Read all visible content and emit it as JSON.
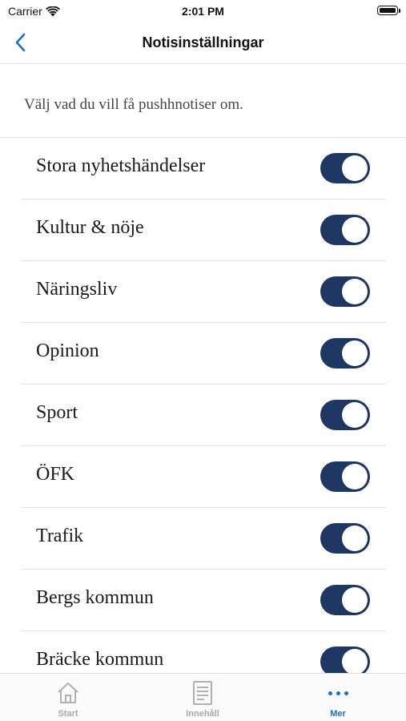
{
  "status_bar": {
    "carrier": "Carrier",
    "time": "2:01 PM",
    "icons": [
      "wifi-icon",
      "battery-icon"
    ]
  },
  "nav": {
    "title": "Notisinställningar",
    "back_icon": "chevron-left-icon",
    "accent_color": "#1f6fbf"
  },
  "intro_text": "Välj vad du vill få pushhnotiser om.",
  "toggle_color": "#1f3763",
  "settings": [
    {
      "label": "Stora nyhetshändelser",
      "enabled": true
    },
    {
      "label": "Kultur & nöje",
      "enabled": true
    },
    {
      "label": "Näringsliv",
      "enabled": true
    },
    {
      "label": "Opinion",
      "enabled": true
    },
    {
      "label": "Sport",
      "enabled": true
    },
    {
      "label": "ÖFK",
      "enabled": true
    },
    {
      "label": "Trafik",
      "enabled": true
    },
    {
      "label": "Bergs kommun",
      "enabled": true
    },
    {
      "label": "Bräcke kommun",
      "enabled": true
    }
  ],
  "tab_bar": {
    "tabs": [
      {
        "label": "Start",
        "icon": "home-icon",
        "active": false
      },
      {
        "label": "Innehåll",
        "icon": "document-icon",
        "active": false
      },
      {
        "label": "Mer",
        "icon": "more-dots-icon",
        "active": true
      }
    ]
  }
}
